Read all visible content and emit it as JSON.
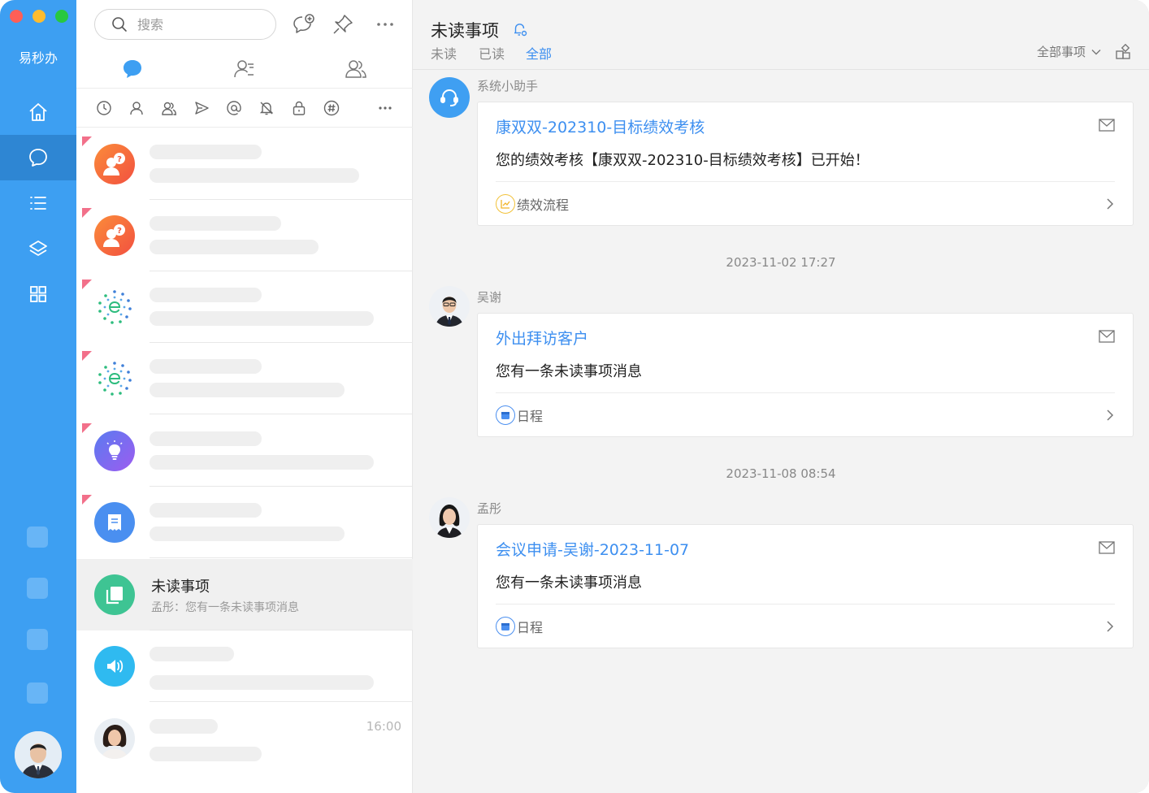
{
  "app": {
    "name": "易秒办"
  },
  "search": {
    "placeholder": "搜索"
  },
  "active_conversation": {
    "title": "未读事项",
    "preview": "孟彤：您有一条未读事项消息"
  },
  "last_conversation": {
    "time": "16:00"
  },
  "main": {
    "title": "未读事项",
    "tabs": [
      {
        "label": "未读"
      },
      {
        "label": "已读"
      },
      {
        "label": "全部"
      }
    ],
    "active_tab": "全部",
    "filter_label": "全部事项",
    "items": [
      {
        "sender": "系统小助手",
        "title": "康双双-202310-目标绩效考核",
        "body": "您的绩效考核【康双双-202310-目标绩效考核】已开始！",
        "category": "绩效流程"
      },
      {
        "timestamp": "2023-11-02 17:27",
        "sender": "吴谢",
        "title": "外出拜访客户",
        "body": "您有一条未读事项消息",
        "category": "日程"
      },
      {
        "timestamp": "2023-11-08 08:54",
        "sender": "孟彤",
        "title": "会议申请-吴谢-2023-11-07",
        "body": "您有一条未读事项消息",
        "category": "日程"
      }
    ]
  },
  "colors": {
    "rail": "#3d9ff2",
    "accent": "#3d8ff0",
    "unread_flag": "#f2708a"
  },
  "icons": {
    "rail": [
      "home-icon",
      "chat-icon",
      "list-icon",
      "layers-icon",
      "apps-grid-icon"
    ],
    "toolbar": [
      "new-chat-icon",
      "pin-icon",
      "more-icon"
    ],
    "tabs": [
      "chat-bubble-icon",
      "contacts-list-icon",
      "users-icon"
    ],
    "filters": [
      "clock-icon",
      "user-icon",
      "group-icon",
      "send-icon",
      "at-icon",
      "mute-icon",
      "lock-icon",
      "hashtag-icon",
      "more-icon"
    ]
  }
}
